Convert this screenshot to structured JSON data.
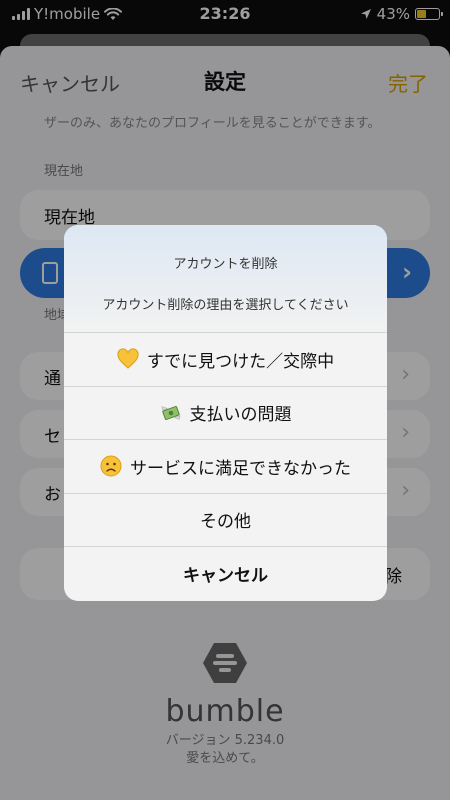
{
  "status_bar": {
    "carrier": "Y!mobile",
    "time": "23:26",
    "battery": "43%"
  },
  "nav": {
    "cancel": "キャンセル",
    "title": "設定",
    "done": "完了"
  },
  "background": {
    "info_text": "ザーのみ、あなたのプロフィールを見ることができます。",
    "location_section": "現在地",
    "location_value": "現在地",
    "map_section_partial": "地域",
    "row1_partial": "通",
    "row2_partial": "セ",
    "row3_partial": "お",
    "delete_partial": "除"
  },
  "brand": {
    "wordmark": "bumble",
    "version": "バージョン 5.234.0",
    "tagline": "愛を込めて。"
  },
  "alert": {
    "title": "アカウントを削除",
    "message": "アカウント削除の理由を選択してください",
    "options": [
      {
        "icon": "yellow-heart-icon",
        "label": "すでに見つけた／交際中"
      },
      {
        "icon": "money-with-wings-icon",
        "label": "支払いの問題"
      },
      {
        "icon": "frowning-face-icon",
        "label": "サービスに満足できなかった"
      },
      {
        "icon": "",
        "label": "その他"
      }
    ],
    "cancel": "キャンセル"
  },
  "colors": {
    "accent": "#d8a000",
    "travel_blue": "#2e7be0"
  }
}
